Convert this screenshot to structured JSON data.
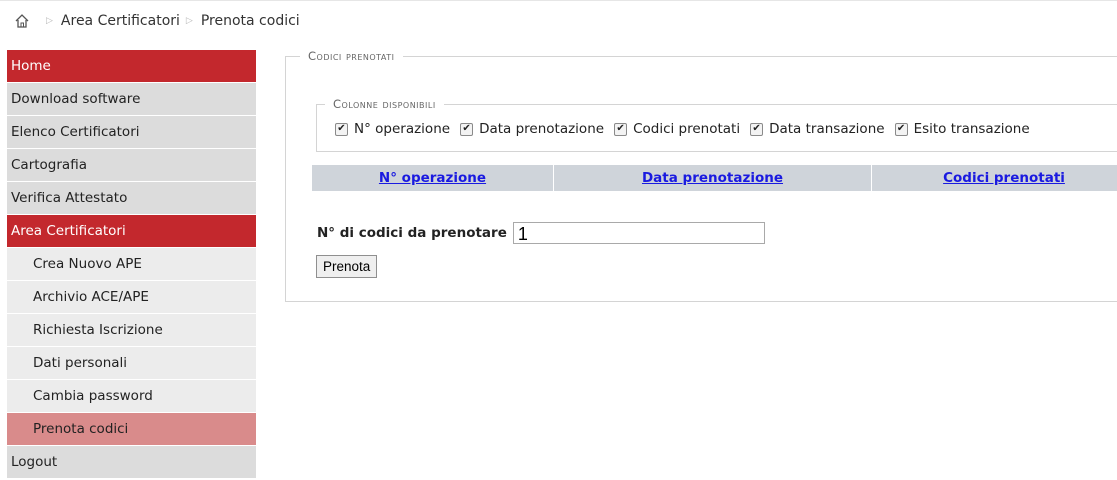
{
  "breadcrumb": {
    "icon": "home-icon",
    "items": [
      "Area Certificatori",
      "Prenota codici"
    ]
  },
  "sidebar": {
    "items": [
      {
        "label": "Home"
      },
      {
        "label": "Download software"
      },
      {
        "label": "Elenco Certificatori"
      },
      {
        "label": "Cartografia"
      },
      {
        "label": "Verifica Attestato"
      },
      {
        "label": "Area Certificatori"
      },
      {
        "label": "Crea Nuovo APE"
      },
      {
        "label": "Archivio ACE/APE"
      },
      {
        "label": "Richiesta Iscrizione"
      },
      {
        "label": "Dati personali"
      },
      {
        "label": "Cambia password"
      },
      {
        "label": "Prenota codici"
      },
      {
        "label": "Logout"
      }
    ]
  },
  "main": {
    "legend": "Codici prenotati",
    "columns_legend": "Colonne disponibili",
    "columns": [
      {
        "label": "N° operazione",
        "checked": true
      },
      {
        "label": "Data prenotazione",
        "checked": true
      },
      {
        "label": "Codici prenotati",
        "checked": true
      },
      {
        "label": "Data transazione",
        "checked": true
      },
      {
        "label": "Esito transazione",
        "checked": true
      }
    ],
    "grid_headers": [
      "N° operazione",
      "Data prenotazione",
      "Codici prenotati"
    ],
    "count_label": "N° di codici da prenotare",
    "count_value": "1",
    "submit_label": "Prenota"
  },
  "colors": {
    "nav_red": "#c3282d",
    "nav_active": "#d98b8b",
    "nav_gray": "#dcdcdc",
    "link_blue": "#1a1ae0"
  }
}
